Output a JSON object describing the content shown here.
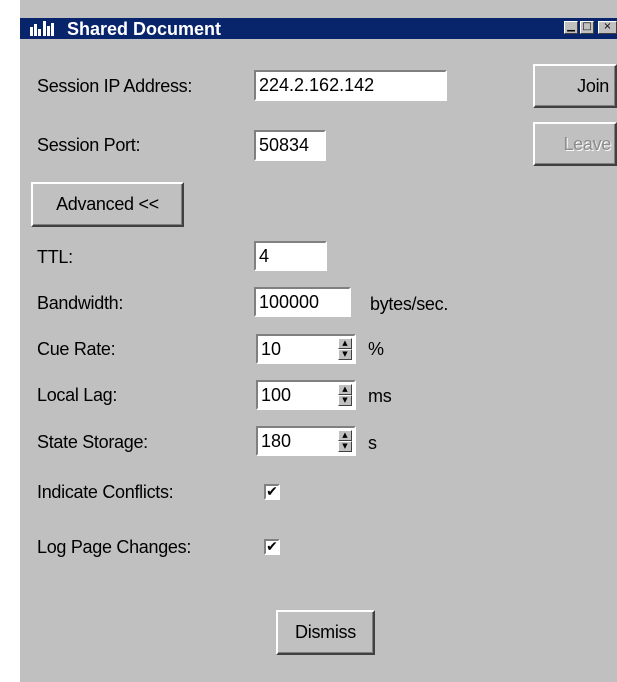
{
  "window": {
    "title": "Shared Document",
    "controls": {
      "minimize_glyph": "▁",
      "maximize_glyph": "□",
      "close_glyph": "×"
    }
  },
  "session": {
    "ip_label": "Session IP Address:",
    "ip_value": "224.2.162.142",
    "port_label": "Session Port:",
    "port_value": "50834",
    "join_label": "Join",
    "leave_label": "Leave"
  },
  "advanced": {
    "toggle_label": "Advanced <<",
    "ttl_label": "TTL:",
    "ttl_value": "4",
    "bandwidth_label": "Bandwidth:",
    "bandwidth_value": "100000",
    "bandwidth_unit": "bytes/sec.",
    "cue_rate_label": "Cue Rate:",
    "cue_rate_value": "10",
    "cue_rate_unit": "%",
    "local_lag_label": "Local Lag:",
    "local_lag_value": "100",
    "local_lag_unit": "ms",
    "state_storage_label": "State Storage:",
    "state_storage_value": "180",
    "state_storage_unit": "s",
    "indicate_conflicts_label": "Indicate Conflicts:",
    "indicate_conflicts_checked": true,
    "log_page_changes_label": "Log Page Changes:",
    "log_page_changes_checked": true,
    "check_glyph": "✔"
  },
  "footer": {
    "dismiss_label": "Dismiss"
  },
  "colors": {
    "titlebar": "#08246b",
    "face": "#c0c0c0",
    "disabled_text": "#8c8c8c"
  }
}
